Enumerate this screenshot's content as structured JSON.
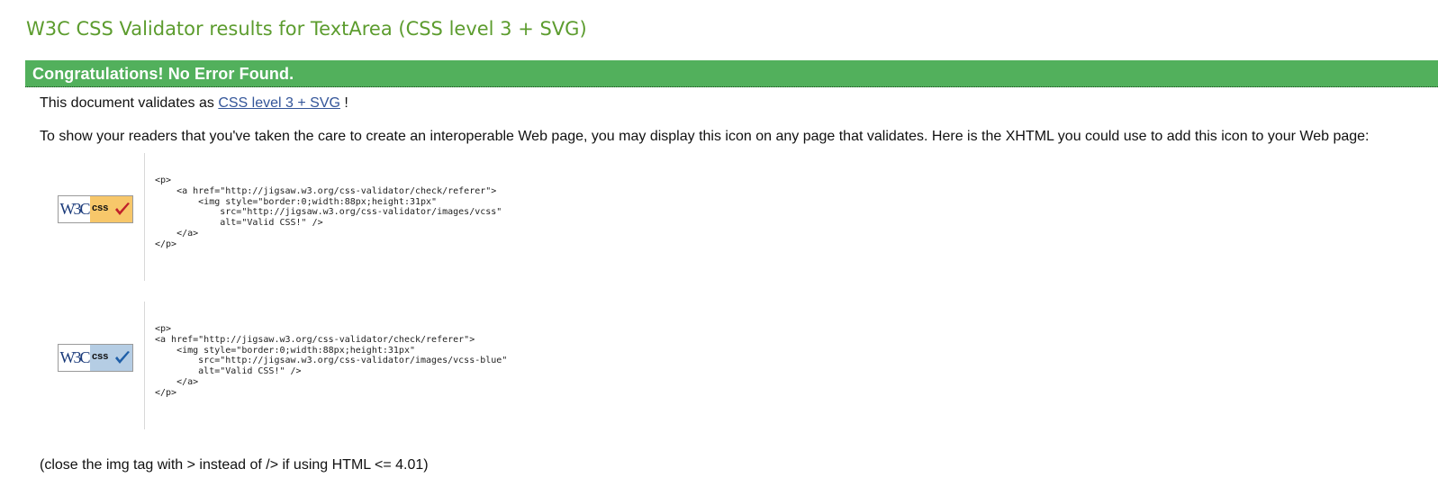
{
  "header": {
    "title": "W3C CSS Validator results for TextArea (CSS level 3 + SVG)"
  },
  "result": {
    "congrats": "Congratulations! No Error Found.",
    "validates_prefix": "This document validates as",
    "validates_link": "CSS level 3 + SVG",
    "validates_suffix": " !",
    "readers_text": "To show your readers that you've taken the care to create an interoperable Web page, you may display this icon on any page that validates. Here is the XHTML you could use to add this icon to your Web page:",
    "close_note": "(close the img tag with > instead of /> if using HTML <= 4.01)"
  },
  "badges": {
    "gold": {
      "icon": "w3c-css-badge-gold",
      "w3c": "W3C",
      "css": "css",
      "bg_color": "#f7c76a",
      "check_color": "#c0202a",
      "code": "<p>\n    <a href=\"http://jigsaw.w3.org/css-validator/check/referer\">\n        <img style=\"border:0;width:88px;height:31px\"\n            src=\"http://jigsaw.w3.org/css-validator/images/vcss\"\n            alt=\"Valid CSS!\" />\n    </a>\n</p>"
    },
    "blue": {
      "icon": "w3c-css-badge-blue",
      "w3c": "W3C",
      "css": "css",
      "bg_color": "#b5cde4",
      "check_color": "#1f5fa8",
      "code": "<p>\n<a href=\"http://jigsaw.w3.org/css-validator/check/referer\">\n    <img style=\"border:0;width:88px;height:31px\"\n        src=\"http://jigsaw.w3.org/css-validator/images/vcss-blue\"\n        alt=\"Valid CSS!\" />\n    </a>\n</p>"
    }
  },
  "colors": {
    "title": "#5c9c2e",
    "congrats_bar": "#52b05c",
    "link": "#335599"
  }
}
